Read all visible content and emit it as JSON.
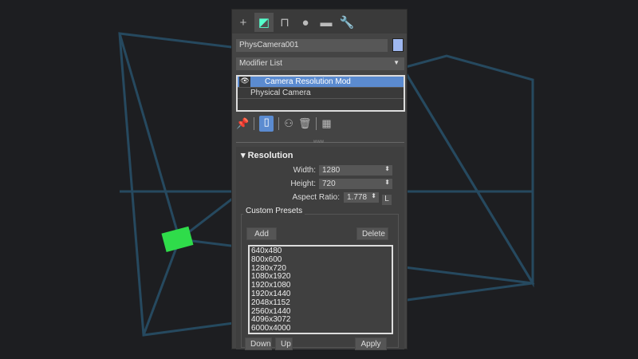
{
  "tabs": [
    {
      "icon": "plus-icon",
      "glyph": "+"
    },
    {
      "icon": "modify-icon",
      "glyph": "◩"
    },
    {
      "icon": "hierarchy-icon",
      "glyph": "⊓"
    },
    {
      "icon": "motion-icon",
      "glyph": "●"
    },
    {
      "icon": "display-icon",
      "glyph": "▬"
    },
    {
      "icon": "utilities-icon",
      "glyph": "🔧"
    }
  ],
  "object_name": "PhysCamera001",
  "modifier_list": "Modifier List",
  "stack": [
    "Camera Resolution Mod",
    "Physical Camera"
  ],
  "rollout": {
    "title": "Resolution",
    "width_label": "Width:",
    "width": "1280",
    "height_label": "Height:",
    "height": "720",
    "aspect_label": "Aspect Ratio:",
    "aspect": "1.778",
    "lock": "L"
  },
  "presets": {
    "title": "Custom Presets",
    "add": "Add",
    "delete": "Delete",
    "down": "Down",
    "up": "Up",
    "apply": "Apply",
    "items": [
      "640x480",
      "800x600",
      "1280x720",
      "1080x1920",
      "1920x1080",
      "1920x1440",
      "2048x1152",
      "2560x1440",
      "4096x3072",
      "6000x4000"
    ]
  },
  "colors": {
    "accent": "#5b8bd0",
    "swatch": "#9fb8f0"
  }
}
